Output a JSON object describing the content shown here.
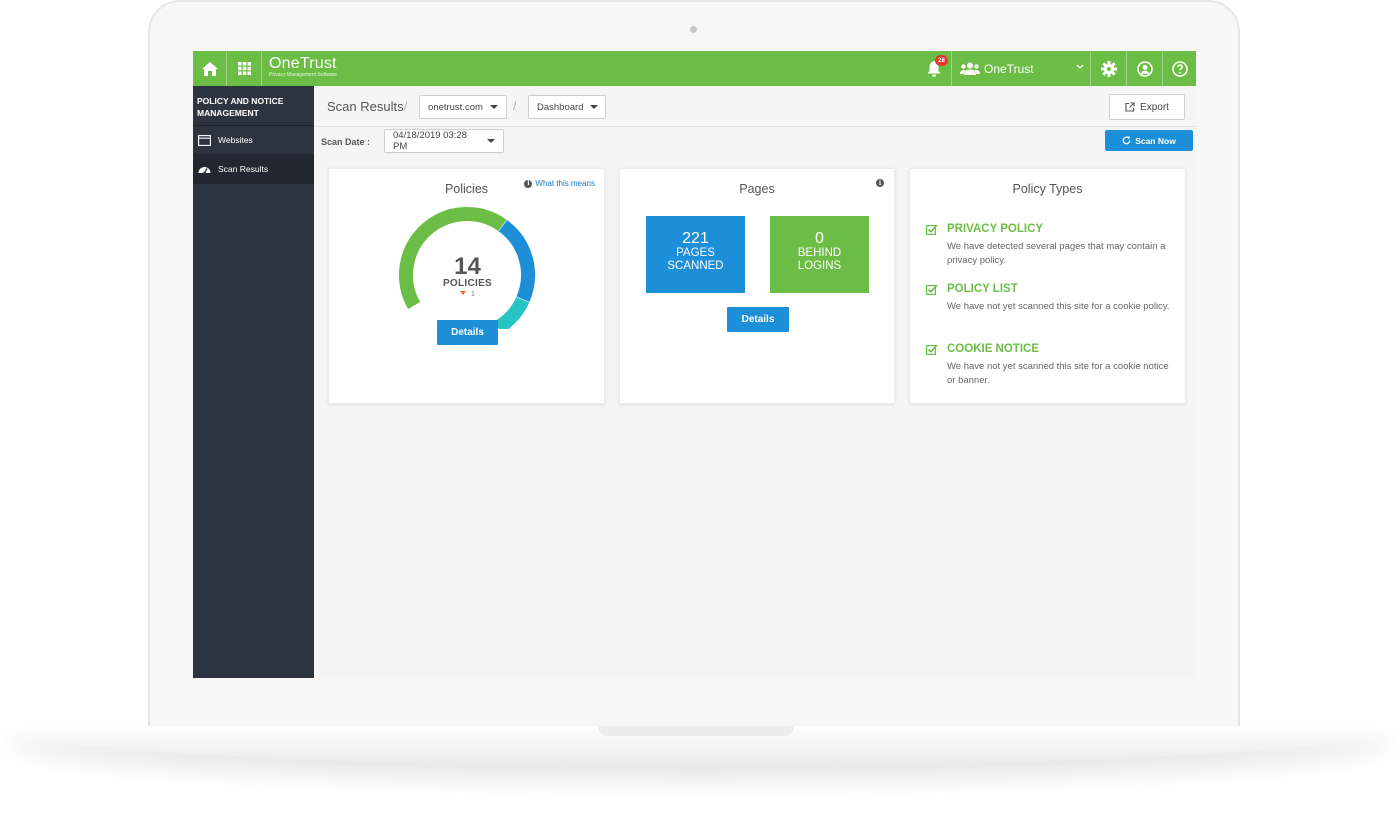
{
  "app": {
    "brand_name": "OneTrust",
    "brand_sub": "Privacy Management Software",
    "notification_count": "28",
    "org_name": "OneTrust"
  },
  "sidebar": {
    "title": "POLICY AND NOTICE MANAGEMENT",
    "items": [
      {
        "label": "Websites",
        "icon": "browser-window-icon",
        "active": false
      },
      {
        "label": "Scan Results",
        "icon": "dashboard-icon",
        "active": true
      }
    ]
  },
  "breadcrumb": {
    "title": "Scan Results",
    "separator": "/",
    "domain": "onetrust.com",
    "view": "Dashboard"
  },
  "toolbar": {
    "export_label": "Export",
    "scan_date_label": "Scan Date :",
    "scan_date_value": "04/18/2019 03:28 PM",
    "scan_now_label": "Scan Now"
  },
  "policies_card": {
    "title": "Policies",
    "info_link": "What this means",
    "count": "14",
    "count_label": "POLICIES",
    "delta": "1",
    "details_label": "Details",
    "gauge_segments": [
      {
        "color": "#6cbd45",
        "fraction": 0.52
      },
      {
        "color": "#1d8ed8",
        "fraction": 0.26
      },
      {
        "color": "#27c4c4",
        "fraction": 0.12
      },
      {
        "color": "#555555",
        "fraction": 0.06
      }
    ]
  },
  "pages_card": {
    "title": "Pages",
    "scanned_value": "221",
    "scanned_label_1": "PAGES",
    "scanned_label_2": "SCANNED",
    "behind_value": "0",
    "behind_label_1": "BEHIND",
    "behind_label_2": "LOGINS",
    "details_label": "Details"
  },
  "policy_types_card": {
    "title": "Policy Types",
    "items": [
      {
        "name": "PRIVACY POLICY",
        "desc": "We have detected several pages that may contain a privacy policy."
      },
      {
        "name": "POLICY LIST",
        "desc": "We have not yet scanned this site for a cookie policy."
      },
      {
        "name": "COOKIE NOTICE",
        "desc": "We have not yet scanned this site for a cookie notice or banner."
      }
    ]
  },
  "colors": {
    "brand_green": "#6cbd45",
    "accent_blue": "#1d8ed8",
    "sidebar_dark": "#2c3440"
  }
}
